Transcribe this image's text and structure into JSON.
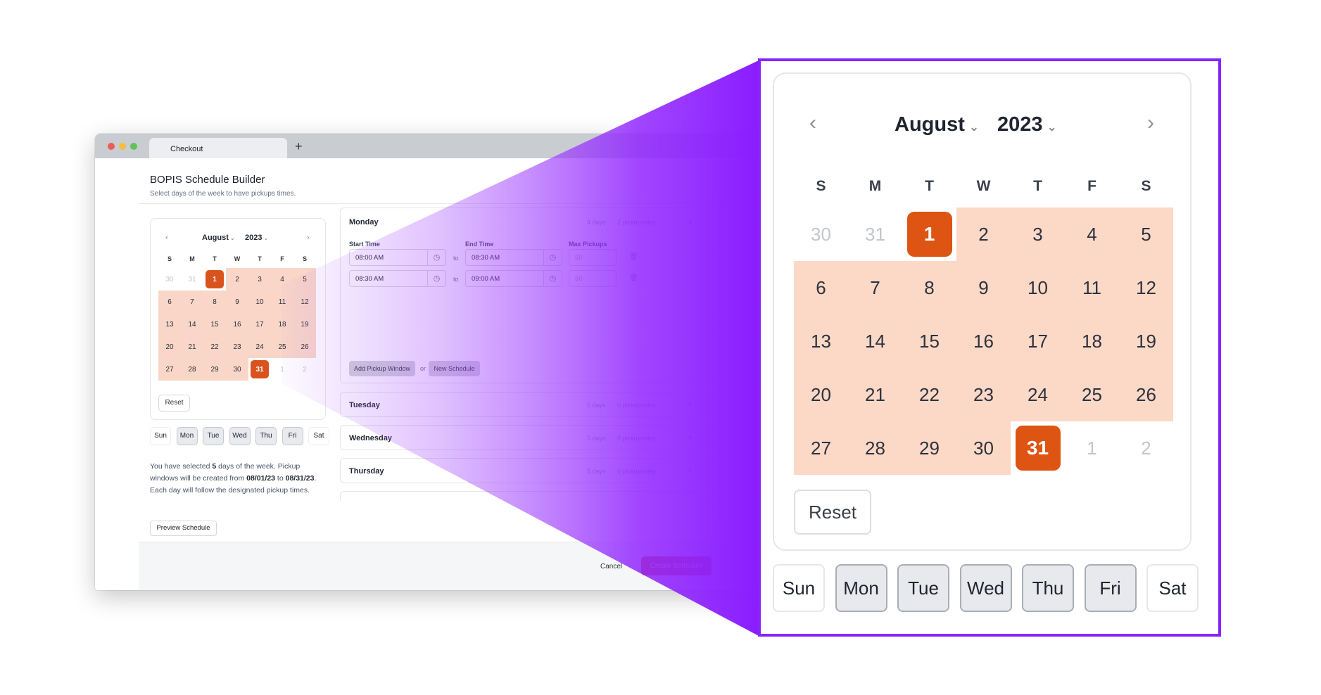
{
  "browser": {
    "tab_title": "Checkout",
    "new_tab_icon": "+"
  },
  "page": {
    "title": "BOPIS Schedule Builder",
    "subtitle": "Select days of the week to have pickups times."
  },
  "calendar": {
    "month": "August",
    "year": "2023",
    "prev_icon": "‹",
    "next_icon": "›",
    "caret_icon": "⌄",
    "weekday_letters": [
      "S",
      "M",
      "T",
      "W",
      "T",
      "F",
      "S"
    ],
    "days": [
      {
        "label": "30",
        "state": "muted"
      },
      {
        "label": "31",
        "state": "muted"
      },
      {
        "label": "1",
        "state": "selected"
      },
      {
        "label": "2",
        "state": "in-range"
      },
      {
        "label": "3",
        "state": "in-range"
      },
      {
        "label": "4",
        "state": "in-range"
      },
      {
        "label": "5",
        "state": "in-range"
      },
      {
        "label": "6",
        "state": "in-range"
      },
      {
        "label": "7",
        "state": "in-range"
      },
      {
        "label": "8",
        "state": "in-range"
      },
      {
        "label": "9",
        "state": "in-range"
      },
      {
        "label": "10",
        "state": "in-range"
      },
      {
        "label": "11",
        "state": "in-range"
      },
      {
        "label": "12",
        "state": "in-range"
      },
      {
        "label": "13",
        "state": "in-range"
      },
      {
        "label": "14",
        "state": "in-range"
      },
      {
        "label": "15",
        "state": "in-range"
      },
      {
        "label": "16",
        "state": "in-range"
      },
      {
        "label": "17",
        "state": "in-range"
      },
      {
        "label": "18",
        "state": "in-range"
      },
      {
        "label": "19",
        "state": "in-range"
      },
      {
        "label": "20",
        "state": "in-range"
      },
      {
        "label": "21",
        "state": "in-range"
      },
      {
        "label": "22",
        "state": "in-range"
      },
      {
        "label": "23",
        "state": "in-range"
      },
      {
        "label": "24",
        "state": "in-range"
      },
      {
        "label": "25",
        "state": "in-range"
      },
      {
        "label": "26",
        "state": "in-range"
      },
      {
        "label": "27",
        "state": "in-range"
      },
      {
        "label": "28",
        "state": "in-range"
      },
      {
        "label": "29",
        "state": "in-range"
      },
      {
        "label": "30",
        "state": "in-range"
      },
      {
        "label": "31",
        "state": "selected"
      },
      {
        "label": "1",
        "state": "muted"
      },
      {
        "label": "2",
        "state": "muted"
      }
    ],
    "reset_label": "Reset"
  },
  "weekday_toggles": [
    {
      "label": "Sun",
      "active": false
    },
    {
      "label": "Mon",
      "active": true
    },
    {
      "label": "Tue",
      "active": true
    },
    {
      "label": "Wed",
      "active": true
    },
    {
      "label": "Thu",
      "active": true
    },
    {
      "label": "Fri",
      "active": true
    },
    {
      "label": "Sat",
      "active": false
    }
  ],
  "summary": {
    "part1": "You have selected ",
    "days_count": "5",
    "part2": " days of the week. Pickup windows will be created from ",
    "start_date": "08/01/23",
    "part3": " to ",
    "end_date": "08/31/23",
    "part4": ". Each day will follow the designated pickup times."
  },
  "preview_button": "Preview Schedule",
  "footer": {
    "cancel_label": "Cancel",
    "create_label": "Create Schedule"
  },
  "monday": {
    "title": "Monday",
    "days_meta": "4 days",
    "pickups_meta": "2 pickups/day",
    "start_time_label": "Start Time",
    "end_time_label": "End Time",
    "max_pickups_label": "Max Pickups",
    "to_label": "to",
    "rows": [
      {
        "start": "08:00 AM",
        "end": "08:30 AM",
        "max": "50"
      },
      {
        "start": "08:30 AM",
        "end": "09:00 AM",
        "max": "50"
      }
    ],
    "add_window_label": "Add Pickup Window",
    "or_label": "or",
    "new_schedule_label": "New Schedule"
  },
  "collapsed_days": [
    {
      "title": "Tuesday",
      "days_meta": "5 days",
      "pickups_meta": "0 pickups/day"
    },
    {
      "title": "Wednesday",
      "days_meta": "5 days",
      "pickups_meta": "0 pickups/day"
    },
    {
      "title": "Thursday",
      "days_meta": "5 days",
      "pickups_meta": "0 pickups/day"
    }
  ],
  "colors": {
    "accent_orange": "#dd5413",
    "range_fill": "#fcd8c7",
    "highlight_purple": "#8a24ff"
  }
}
